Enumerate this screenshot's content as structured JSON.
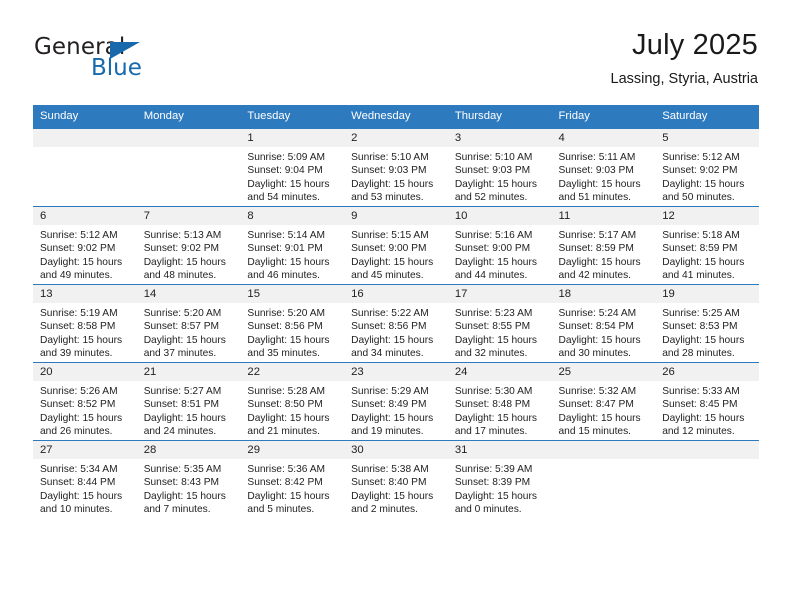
{
  "logo": {
    "word_one": "General",
    "word_two": "Blue",
    "triangle_icon": "triangle-icon",
    "brand_color": "#1769ab"
  },
  "header": {
    "title": "July 2025",
    "subtitle": "Lassing, Styria, Austria"
  },
  "theme": {
    "header_blue": "#2e7abf",
    "daynum_gray": "#f1f1f1",
    "text": "#1a1a1a"
  },
  "weekday_headers": [
    "Sunday",
    "Monday",
    "Tuesday",
    "Wednesday",
    "Thursday",
    "Friday",
    "Saturday"
  ],
  "labels": {
    "sunrise_prefix": "Sunrise:",
    "sunset_prefix": "Sunset:",
    "daylight_prefix": "Daylight:"
  },
  "weeks": [
    [
      {
        "day": "",
        "sunrise": "",
        "sunset": "",
        "daylight_line1": "",
        "daylight_line2": ""
      },
      {
        "day": "",
        "sunrise": "",
        "sunset": "",
        "daylight_line1": "",
        "daylight_line2": ""
      },
      {
        "day": "1",
        "sunrise": "Sunrise: 5:09 AM",
        "sunset": "Sunset: 9:04 PM",
        "daylight_line1": "Daylight: 15 hours",
        "daylight_line2": "and 54 minutes."
      },
      {
        "day": "2",
        "sunrise": "Sunrise: 5:10 AM",
        "sunset": "Sunset: 9:03 PM",
        "daylight_line1": "Daylight: 15 hours",
        "daylight_line2": "and 53 minutes."
      },
      {
        "day": "3",
        "sunrise": "Sunrise: 5:10 AM",
        "sunset": "Sunset: 9:03 PM",
        "daylight_line1": "Daylight: 15 hours",
        "daylight_line2": "and 52 minutes."
      },
      {
        "day": "4",
        "sunrise": "Sunrise: 5:11 AM",
        "sunset": "Sunset: 9:03 PM",
        "daylight_line1": "Daylight: 15 hours",
        "daylight_line2": "and 51 minutes."
      },
      {
        "day": "5",
        "sunrise": "Sunrise: 5:12 AM",
        "sunset": "Sunset: 9:02 PM",
        "daylight_line1": "Daylight: 15 hours",
        "daylight_line2": "and 50 minutes."
      }
    ],
    [
      {
        "day": "6",
        "sunrise": "Sunrise: 5:12 AM",
        "sunset": "Sunset: 9:02 PM",
        "daylight_line1": "Daylight: 15 hours",
        "daylight_line2": "and 49 minutes."
      },
      {
        "day": "7",
        "sunrise": "Sunrise: 5:13 AM",
        "sunset": "Sunset: 9:02 PM",
        "daylight_line1": "Daylight: 15 hours",
        "daylight_line2": "and 48 minutes."
      },
      {
        "day": "8",
        "sunrise": "Sunrise: 5:14 AM",
        "sunset": "Sunset: 9:01 PM",
        "daylight_line1": "Daylight: 15 hours",
        "daylight_line2": "and 46 minutes."
      },
      {
        "day": "9",
        "sunrise": "Sunrise: 5:15 AM",
        "sunset": "Sunset: 9:00 PM",
        "daylight_line1": "Daylight: 15 hours",
        "daylight_line2": "and 45 minutes."
      },
      {
        "day": "10",
        "sunrise": "Sunrise: 5:16 AM",
        "sunset": "Sunset: 9:00 PM",
        "daylight_line1": "Daylight: 15 hours",
        "daylight_line2": "and 44 minutes."
      },
      {
        "day": "11",
        "sunrise": "Sunrise: 5:17 AM",
        "sunset": "Sunset: 8:59 PM",
        "daylight_line1": "Daylight: 15 hours",
        "daylight_line2": "and 42 minutes."
      },
      {
        "day": "12",
        "sunrise": "Sunrise: 5:18 AM",
        "sunset": "Sunset: 8:59 PM",
        "daylight_line1": "Daylight: 15 hours",
        "daylight_line2": "and 41 minutes."
      }
    ],
    [
      {
        "day": "13",
        "sunrise": "Sunrise: 5:19 AM",
        "sunset": "Sunset: 8:58 PM",
        "daylight_line1": "Daylight: 15 hours",
        "daylight_line2": "and 39 minutes."
      },
      {
        "day": "14",
        "sunrise": "Sunrise: 5:20 AM",
        "sunset": "Sunset: 8:57 PM",
        "daylight_line1": "Daylight: 15 hours",
        "daylight_line2": "and 37 minutes."
      },
      {
        "day": "15",
        "sunrise": "Sunrise: 5:20 AM",
        "sunset": "Sunset: 8:56 PM",
        "daylight_line1": "Daylight: 15 hours",
        "daylight_line2": "and 35 minutes."
      },
      {
        "day": "16",
        "sunrise": "Sunrise: 5:22 AM",
        "sunset": "Sunset: 8:56 PM",
        "daylight_line1": "Daylight: 15 hours",
        "daylight_line2": "and 34 minutes."
      },
      {
        "day": "17",
        "sunrise": "Sunrise: 5:23 AM",
        "sunset": "Sunset: 8:55 PM",
        "daylight_line1": "Daylight: 15 hours",
        "daylight_line2": "and 32 minutes."
      },
      {
        "day": "18",
        "sunrise": "Sunrise: 5:24 AM",
        "sunset": "Sunset: 8:54 PM",
        "daylight_line1": "Daylight: 15 hours",
        "daylight_line2": "and 30 minutes."
      },
      {
        "day": "19",
        "sunrise": "Sunrise: 5:25 AM",
        "sunset": "Sunset: 8:53 PM",
        "daylight_line1": "Daylight: 15 hours",
        "daylight_line2": "and 28 minutes."
      }
    ],
    [
      {
        "day": "20",
        "sunrise": "Sunrise: 5:26 AM",
        "sunset": "Sunset: 8:52 PM",
        "daylight_line1": "Daylight: 15 hours",
        "daylight_line2": "and 26 minutes."
      },
      {
        "day": "21",
        "sunrise": "Sunrise: 5:27 AM",
        "sunset": "Sunset: 8:51 PM",
        "daylight_line1": "Daylight: 15 hours",
        "daylight_line2": "and 24 minutes."
      },
      {
        "day": "22",
        "sunrise": "Sunrise: 5:28 AM",
        "sunset": "Sunset: 8:50 PM",
        "daylight_line1": "Daylight: 15 hours",
        "daylight_line2": "and 21 minutes."
      },
      {
        "day": "23",
        "sunrise": "Sunrise: 5:29 AM",
        "sunset": "Sunset: 8:49 PM",
        "daylight_line1": "Daylight: 15 hours",
        "daylight_line2": "and 19 minutes."
      },
      {
        "day": "24",
        "sunrise": "Sunrise: 5:30 AM",
        "sunset": "Sunset: 8:48 PM",
        "daylight_line1": "Daylight: 15 hours",
        "daylight_line2": "and 17 minutes."
      },
      {
        "day": "25",
        "sunrise": "Sunrise: 5:32 AM",
        "sunset": "Sunset: 8:47 PM",
        "daylight_line1": "Daylight: 15 hours",
        "daylight_line2": "and 15 minutes."
      },
      {
        "day": "26",
        "sunrise": "Sunrise: 5:33 AM",
        "sunset": "Sunset: 8:45 PM",
        "daylight_line1": "Daylight: 15 hours",
        "daylight_line2": "and 12 minutes."
      }
    ],
    [
      {
        "day": "27",
        "sunrise": "Sunrise: 5:34 AM",
        "sunset": "Sunset: 8:44 PM",
        "daylight_line1": "Daylight: 15 hours",
        "daylight_line2": "and 10 minutes."
      },
      {
        "day": "28",
        "sunrise": "Sunrise: 5:35 AM",
        "sunset": "Sunset: 8:43 PM",
        "daylight_line1": "Daylight: 15 hours",
        "daylight_line2": "and 7 minutes."
      },
      {
        "day": "29",
        "sunrise": "Sunrise: 5:36 AM",
        "sunset": "Sunset: 8:42 PM",
        "daylight_line1": "Daylight: 15 hours",
        "daylight_line2": "and 5 minutes."
      },
      {
        "day": "30",
        "sunrise": "Sunrise: 5:38 AM",
        "sunset": "Sunset: 8:40 PM",
        "daylight_line1": "Daylight: 15 hours",
        "daylight_line2": "and 2 minutes."
      },
      {
        "day": "31",
        "sunrise": "Sunrise: 5:39 AM",
        "sunset": "Sunset: 8:39 PM",
        "daylight_line1": "Daylight: 15 hours",
        "daylight_line2": "and 0 minutes."
      },
      {
        "day": "",
        "sunrise": "",
        "sunset": "",
        "daylight_line1": "",
        "daylight_line2": ""
      },
      {
        "day": "",
        "sunrise": "",
        "sunset": "",
        "daylight_line1": "",
        "daylight_line2": ""
      }
    ]
  ]
}
